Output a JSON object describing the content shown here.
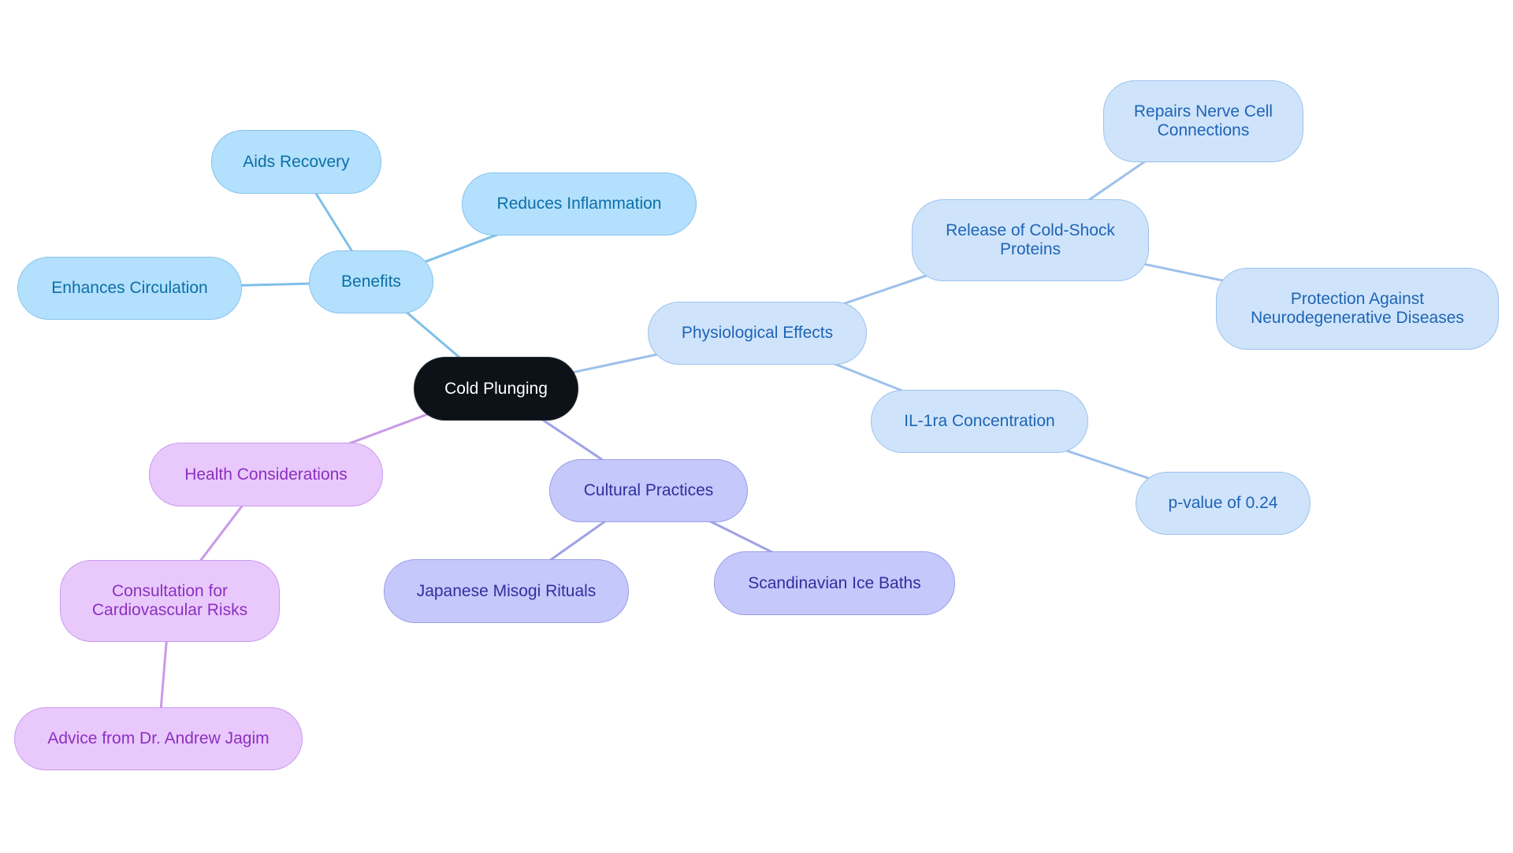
{
  "diagram": {
    "type": "mindmap",
    "root": {
      "id": "root",
      "label": "Cold Plunging"
    },
    "group_colors": {
      "benefits": {
        "fill": "#b3e0fd",
        "stroke": "#86c3ea",
        "text": "#0c6fa6",
        "edge": "#7fbfe8"
      },
      "physio": {
        "fill": "#cfe4fb",
        "stroke": "#9cc2ec",
        "text": "#1f64b4",
        "edge": "#9cc0ea"
      },
      "cultural": {
        "fill": "#c5c8fb",
        "stroke": "#9a9ee8",
        "text": "#2e309d",
        "edge": "#9ea2e6"
      },
      "health": {
        "fill": "#e9c9fc",
        "stroke": "#c99aee",
        "text": "#8b30bf",
        "edge": "#c99ae8"
      }
    },
    "nodes": [
      {
        "id": "root",
        "label": "Cold Plunging",
        "group": "root"
      },
      {
        "id": "benefits",
        "label": "Benefits",
        "group": "benefits",
        "parent": "root"
      },
      {
        "id": "aids",
        "label": "Aids Recovery",
        "group": "benefits",
        "parent": "benefits"
      },
      {
        "id": "reduces",
        "label": "Reduces Inflammation",
        "group": "benefits",
        "parent": "benefits"
      },
      {
        "id": "enhances",
        "label": "Enhances Circulation",
        "group": "benefits",
        "parent": "benefits"
      },
      {
        "id": "physio",
        "label": "Physiological Effects",
        "group": "physio",
        "parent": "root"
      },
      {
        "id": "release",
        "label": "Release of Cold-Shock Proteins",
        "lines": [
          "Release of Cold-Shock",
          "Proteins"
        ],
        "group": "physio",
        "parent": "physio"
      },
      {
        "id": "repairs",
        "label": "Repairs Nerve Cell Connections",
        "lines": [
          "Repairs Nerve Cell",
          "Connections"
        ],
        "group": "physio",
        "parent": "release"
      },
      {
        "id": "protection",
        "label": "Protection Against Neurodegenerative Diseases",
        "lines": [
          "Protection Against",
          "Neurodegenerative Diseases"
        ],
        "group": "physio",
        "parent": "release"
      },
      {
        "id": "il1ra",
        "label": "IL-1ra Concentration",
        "group": "physio",
        "parent": "physio"
      },
      {
        "id": "pvalue",
        "label": "p-value of 0.24",
        "group": "physio",
        "parent": "il1ra"
      },
      {
        "id": "cultural",
        "label": "Cultural Practices",
        "group": "cultural",
        "parent": "root"
      },
      {
        "id": "japanese",
        "label": "Japanese Misogi Rituals",
        "group": "cultural",
        "parent": "cultural"
      },
      {
        "id": "scandinavian",
        "label": "Scandinavian Ice Baths",
        "group": "cultural",
        "parent": "cultural"
      },
      {
        "id": "health",
        "label": "Health Considerations",
        "group": "health",
        "parent": "root"
      },
      {
        "id": "consultation",
        "label": "Consultation for Cardiovascular Risks",
        "lines": [
          "Consultation for",
          "Cardiovascular Risks"
        ],
        "group": "health",
        "parent": "health"
      },
      {
        "id": "advice",
        "label": "Advice from Dr. Andrew Jagim",
        "group": "health",
        "parent": "consultation"
      }
    ]
  }
}
